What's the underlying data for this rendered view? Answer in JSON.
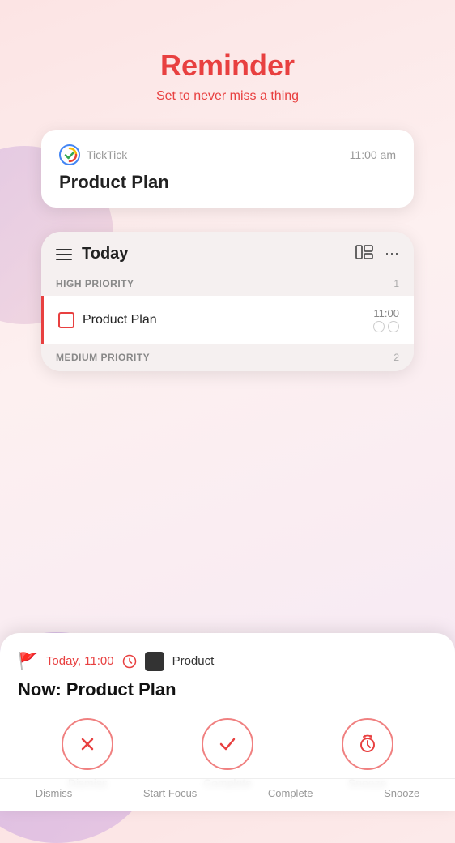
{
  "header": {
    "title": "Reminder",
    "subtitle": "Set to never miss a thing"
  },
  "notification": {
    "app_name": "TickTick",
    "time": "11:00 am",
    "task_title": "Product Plan"
  },
  "app_screen": {
    "title": "Today",
    "high_priority": {
      "label": "HIGH PRIORITY",
      "count": "1",
      "task": {
        "name": "Product Plan",
        "time": "11:00"
      }
    },
    "medium_priority": {
      "label": "MEDIUM PRIORITY",
      "count": "2"
    }
  },
  "action_sheet": {
    "time": "Today, 11:00",
    "product_label": "Product",
    "task_title": "Now: Product Plan",
    "buttons": {
      "dismiss": "Dismiss",
      "complete": "Complete",
      "snooze": "Snooze"
    }
  },
  "bottom_bar": {
    "items": [
      "Dismiss",
      "Start Focus",
      "Complete",
      "Snooze"
    ]
  }
}
